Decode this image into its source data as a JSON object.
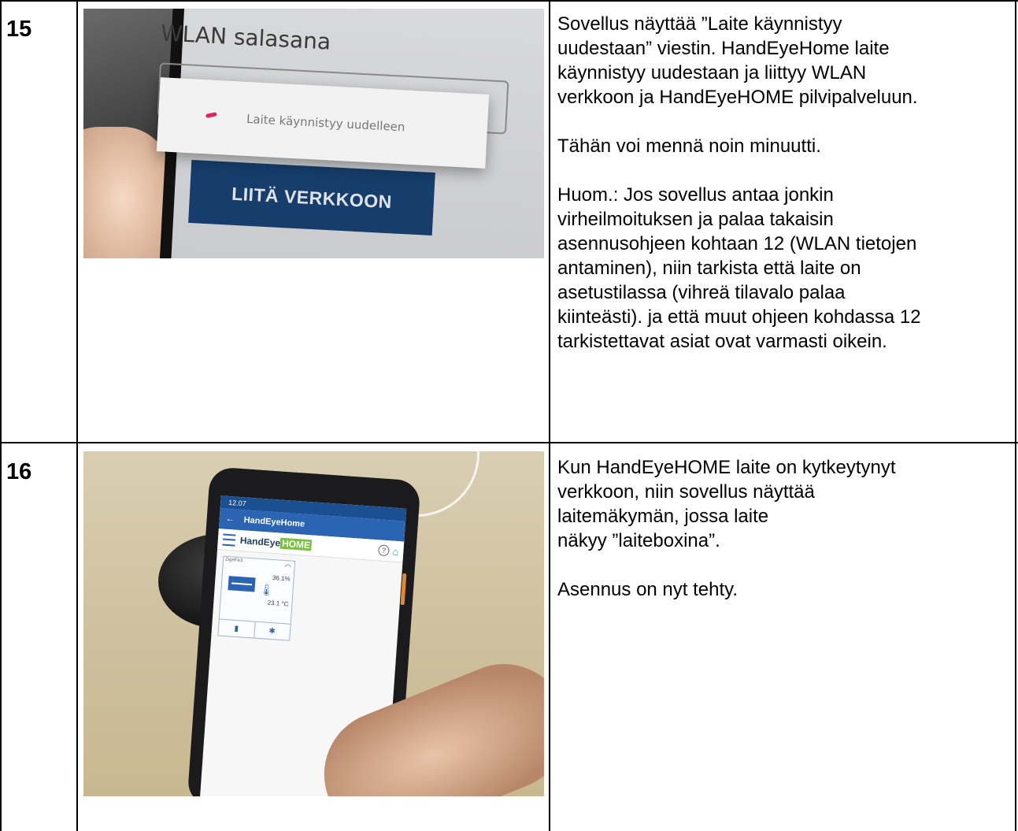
{
  "rows": [
    {
      "number": "15",
      "photo": {
        "wlan_label": "WLAN salasana",
        "dialog_message": "Laite käynnistyy uudelleen",
        "button_label": "LIITÄ VERKKOON"
      },
      "paragraphs": [
        "Sovellus näyttää ”Laite käynnistyy\nuudestaan” viestin.  HandEyeHome laite\nkäynnistyy uudestaan ja liittyy WLAN\nverkkoon ja HandEyeHOME pilvipalveluun.",
        "Tähän voi mennä noin minuutti.",
        "Huom.: Jos sovellus antaa jonkin\nvirheilmoituksen ja palaa takaisin\nasennusohjeen kohtaan 12 (WLAN tietojen\nantaminen), niin tarkista että laite on\nasetustilassa (vihreä tilavalo palaa\nkiinteästi). ja että muut ohjeen kohdassa 12\ntarkistettavat asiat ovat varmasti oikein."
      ]
    },
    {
      "number": "16",
      "photo": {
        "status_time": "12.07",
        "app_title": "HandEyeHome",
        "logo_part1": "HandEye",
        "logo_part2": "HOME",
        "device_name": "ZigeFe3",
        "humidity": "36.1%",
        "temperature": "23.1 °C"
      },
      "paragraphs": [
        "Kun HandEyeHOME laite on kytkeytynyt\nverkkoon, niin sovellus näyttää\nlaitemäkymän, jossa laite\nnäkyy ”laiteboxina”.",
        "Asennus on nyt tehty."
      ]
    }
  ]
}
